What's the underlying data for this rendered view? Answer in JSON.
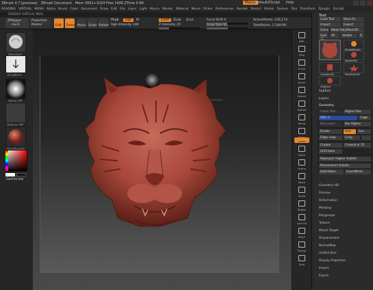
{
  "title_bar": {
    "items": [
      "ZBrush 4.7 [preview]",
      "ZBrush Document",
      "Mem 3931+1024 Free 1406 ZTime 0.84"
    ],
    "right_items": [
      "Menus",
      "DefaultZScript",
      "Help"
    ]
  },
  "menu_bar": {
    "items": [
      "READING",
      "VIRTUAL",
      "MENU",
      "Alpha",
      "Brush",
      "Color",
      "Document",
      "Draw",
      "Edit",
      "File",
      "Layer",
      "Light",
      "Macro",
      "Marker",
      "Material",
      "Movie",
      "Picker",
      "Preferences",
      "Render",
      "Stencil",
      "Stroke",
      "Texture",
      "Tool",
      "Transform",
      "Zplugin",
      "Zscript"
    ]
  },
  "status": {
    "text": "RENDER VIRTUAL MEN..."
  },
  "toolbar": {
    "zmapper": "ZMapper",
    "zmapper_sub": "rev-E",
    "projection": "Projection",
    "projection_sub": "Master",
    "quick": "Quick",
    "edit": "Edit",
    "draw": "Draw",
    "move": "Move",
    "scale": "Scale",
    "rotate": "Rotate",
    "mrgb": "Mrgb",
    "rgb": "Rgb",
    "m": "M",
    "zadd": "Zadd",
    "zsub": "Zsub",
    "zcut": "Zcut",
    "rgb_intensity": "Rgb Intensity 100",
    "z_intensity": "Z Intensity 25",
    "focal_shift": "Focal Shift 0",
    "draw_size": "Draw Size 64",
    "active_points": "ActivePoints: 226,174",
    "total_points": "TotalPoints: 1.248 Mil"
  },
  "left_tools": {
    "brush_label": "Standard",
    "stroke_label": "DragRect",
    "alpha_label": "Alpha Off",
    "texture_label": "Texture Off",
    "material_label": "SkinShade4",
    "color_label": "SwitchColor"
  },
  "right_shelf": {
    "buttons": [
      "BPR",
      "SPix",
      "Scroll",
      "Zoom",
      "Actual",
      "AAHalf",
      "Persp",
      "Floor",
      "Local",
      "LSym",
      "Frame",
      "Move",
      "Scale",
      "Rotate",
      "Line Fill",
      "PolyF",
      "Transp",
      "Solo"
    ],
    "highlight": "Local"
  },
  "palette": {
    "header": "Tool",
    "load_tool": "Load Tool",
    "save_as": "Save As",
    "import": "Import",
    "export": "Export",
    "clone": "Clone",
    "make_polymesh": "Make PolyMesh3D",
    "goz": "GoZ",
    "all": "All",
    "visible": "Visible",
    "r": "R",
    "subtool_count": "12",
    "subtool_items": [
      "SimpleBrush",
      "Sphere3D",
      "Cylinder3D",
      "PolyMesh3D",
      "ZSphere"
    ],
    "sections_top": [
      "SubTool",
      "Layers",
      "Geometry"
    ],
    "geometry": {
      "lower_res": "Lower Res",
      "higher_res": "Higher Res",
      "sdiv": "SDiv 5",
      "cage": "Cage",
      "del_lower": "Del Lower",
      "del_higher": "Del Higher",
      "divide": "Divide",
      "smt": "Smt",
      "suv": "Suv",
      "edge_loop": "Edge Loop",
      "crisp": "Crisp",
      "crease": "Crease",
      "crease_lvl": "CreaseLvl 15",
      "uncrease": "UnCrease",
      "reproject": "Reproject Higher Subdiv",
      "reconstruct": "Reconstruct Subdiv",
      "del_hidden": "DelHidden",
      "insert_mesh": "InsertMesh"
    },
    "sections_bottom": [
      "Geometry HD",
      "Preview",
      "Deformation",
      "Masking",
      "Polygroups",
      "Texture",
      "Morph Target",
      "Displacement",
      "NormalMap",
      "Unified Skin",
      "Display Properties",
      "Import",
      "Export"
    ]
  },
  "colors": {
    "accent": "#e8872e",
    "highlight": "#3a6cd8",
    "sculpt": "#a8483a"
  }
}
